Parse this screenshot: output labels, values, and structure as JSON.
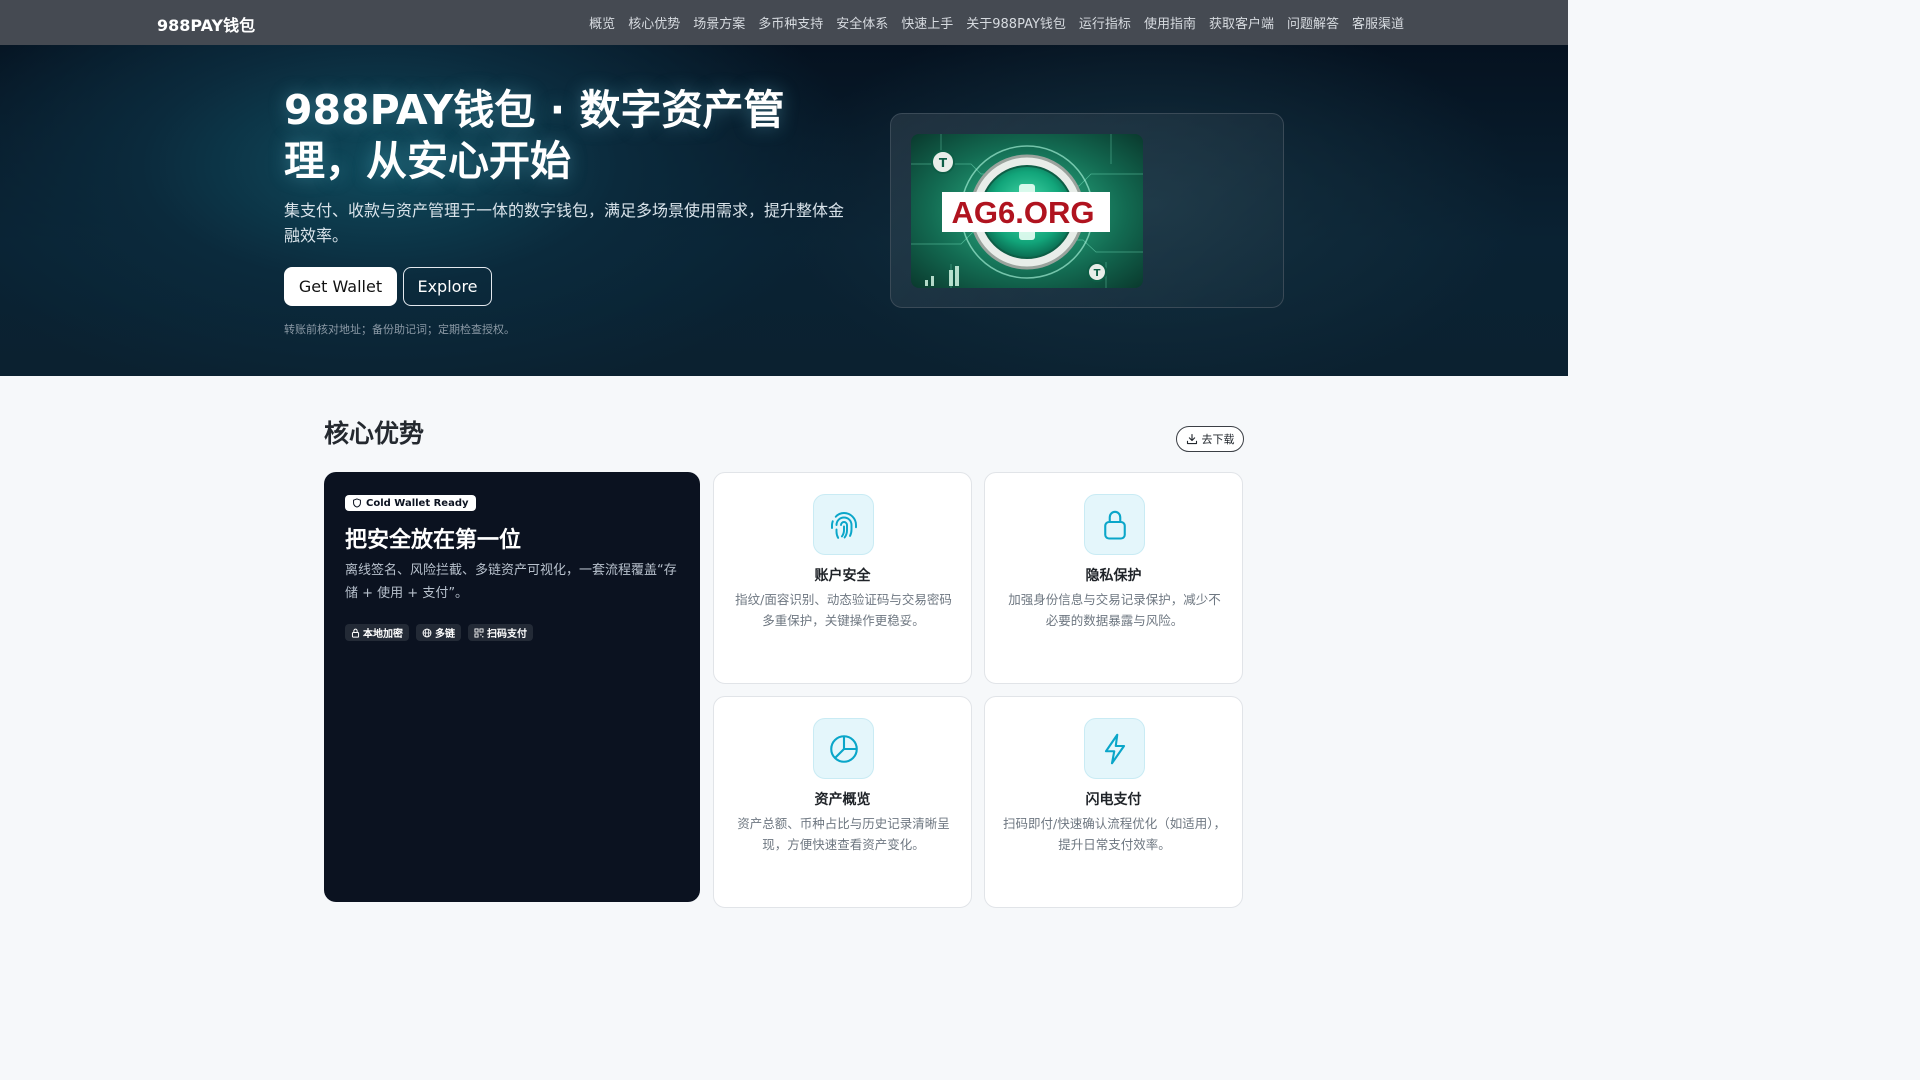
{
  "nav": {
    "brand": "988PAY钱包",
    "links": [
      "概览",
      "核心优势",
      "场景方案",
      "多币种支持",
      "安全体系",
      "快速上手",
      "关于988PAY钱包",
      "运行指标",
      "使用指南",
      "获取客户端",
      "问题解答",
      "客服渠道"
    ]
  },
  "hero": {
    "title": "988PAY钱包 · 数字资产管理，从安心开始",
    "subtitle": "集支付、收款与资产管理于一体的数字钱包，满足多场景使用需求，提升整体金融效率。",
    "primary_button": "Get Wallet",
    "secondary_button": "Explore",
    "note": "转账前核对地址；备份助记词；定期检查授权。",
    "image_text": "AG6.ORG"
  },
  "section": {
    "title": "核心优势",
    "download_button": "去下载"
  },
  "feature_dark": {
    "badge": "Cold Wallet Ready",
    "title": "把安全放在第一位",
    "description": "离线签名、风险拦截、多链资产可视化，一套流程覆盖“存储 + 使用 + 支付”。",
    "chips": [
      "本地加密",
      "多链",
      "扫码支付"
    ]
  },
  "features": [
    {
      "title": "账户安全",
      "description": "指纹/面容识别、动态验证码与交易密码多重保护，关键操作更稳妥。",
      "icon": "fingerprint-icon"
    },
    {
      "title": "隐私保护",
      "description": "加强身份信息与交易记录保护，减少不必要的数据暴露与风险。",
      "icon": "lock-icon"
    },
    {
      "title": "资产概览",
      "description": "资产总额、币种占比与历史记录清晰呈现，方便快速查看资产变化。",
      "icon": "pie-chart-icon"
    },
    {
      "title": "闪电支付",
      "description": "扫码即付/快速确认流程优化（如适用），提升日常支付效率。",
      "icon": "lightning-icon"
    }
  ],
  "colors": {
    "accent": "#0aa6c9",
    "nav_bg": "#454a52",
    "dark_card": "#0b1220"
  }
}
